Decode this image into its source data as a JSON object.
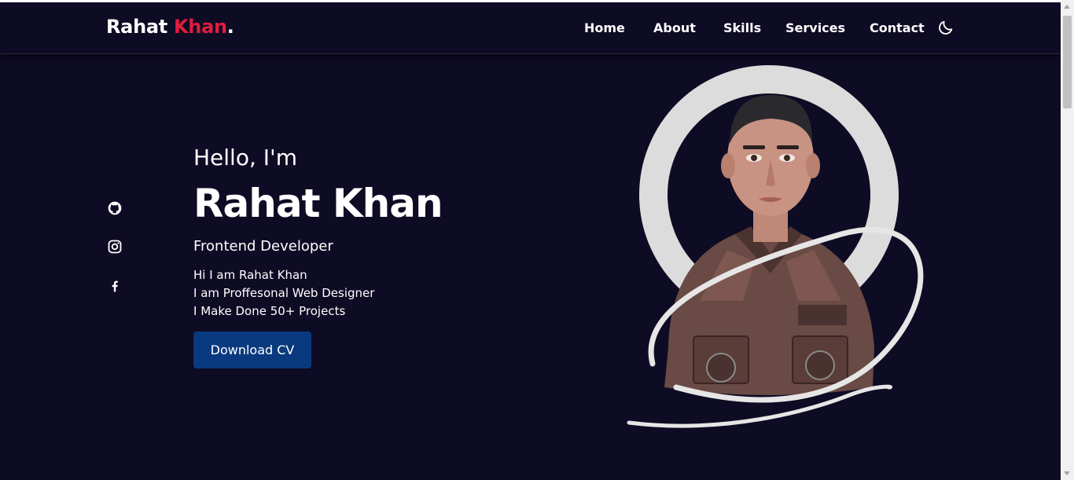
{
  "brand": {
    "first": "Rahat",
    "accent": "Khan",
    "dot": ".",
    "accent_color": "#e11d3f"
  },
  "nav": {
    "items": [
      {
        "label": "Home"
      },
      {
        "label": "About"
      },
      {
        "label": "Skills"
      },
      {
        "label": "Services"
      },
      {
        "label": "Contact"
      }
    ],
    "theme_toggle_icon": "moon-icon"
  },
  "social": [
    {
      "icon": "github-icon"
    },
    {
      "icon": "instagram-icon"
    },
    {
      "icon": "facebook-icon"
    }
  ],
  "hero": {
    "greeting": "Hello, I'm",
    "name": "Rahat Khan",
    "role": "Frontend Developer",
    "bio": [
      "Hi I am Rahat Khan",
      "I am Proffesonal Web Designer",
      "I Make Done 50+ Projects"
    ],
    "cta_label": "Download CV",
    "cta_color": "#093a7f",
    "portrait_icon": "profile-portrait-image"
  },
  "theme": {
    "background": "#0e0b24",
    "text": "#ffffff"
  }
}
